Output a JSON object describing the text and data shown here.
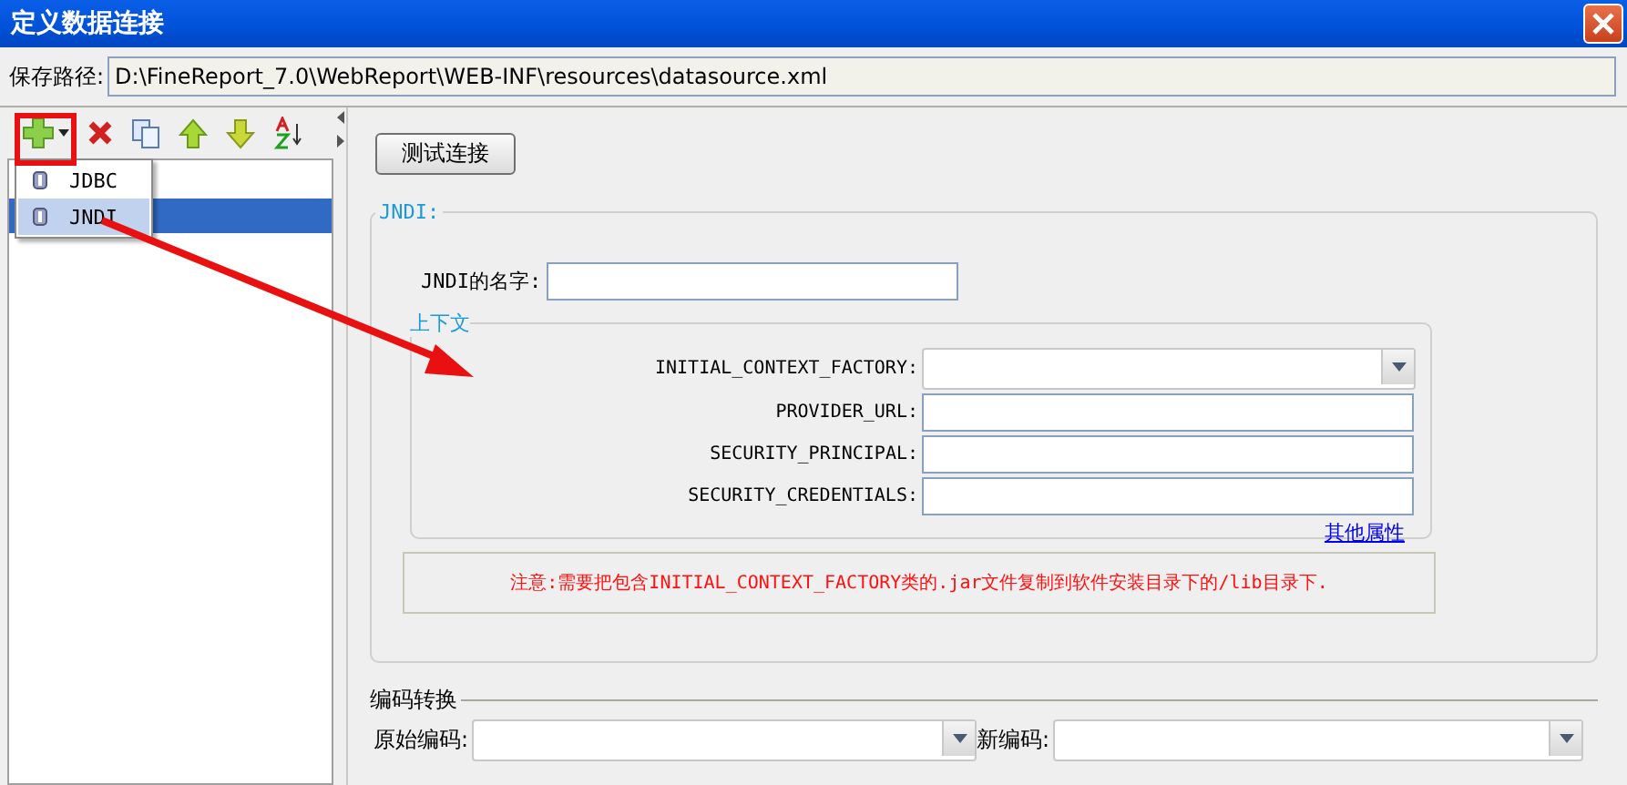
{
  "window": {
    "title": "定义数据连接"
  },
  "save_path": {
    "label": "保存路径:",
    "value": "D:\\FineReport_7.0\\WebReport\\WEB-INF\\resources\\datasource.xml"
  },
  "add_menu": {
    "items": [
      {
        "label": "JDBC",
        "selected": false
      },
      {
        "label": "JNDI",
        "selected": true
      }
    ]
  },
  "test_button": "测试连接",
  "jndi_group": {
    "title": "JNDI:",
    "name_label": "JNDI的名字:",
    "context": {
      "title": "上下文",
      "fields": [
        {
          "label": "INITIAL_CONTEXT_FACTORY:",
          "kind": "combo"
        },
        {
          "label": "PROVIDER_URL:",
          "kind": "text"
        },
        {
          "label": "SECURITY_PRINCIPAL:",
          "kind": "text"
        },
        {
          "label": "SECURITY_CREDENTIALS:",
          "kind": "text"
        }
      ],
      "more_link": "其他属性"
    },
    "note": "注意:需要把包含INITIAL_CONTEXT_FACTORY类的.jar文件复制到软件安装目录下的/lib目录下."
  },
  "encoding": {
    "title": "编码转换",
    "source_label": "原始编码:",
    "target_label": "新编码:"
  }
}
